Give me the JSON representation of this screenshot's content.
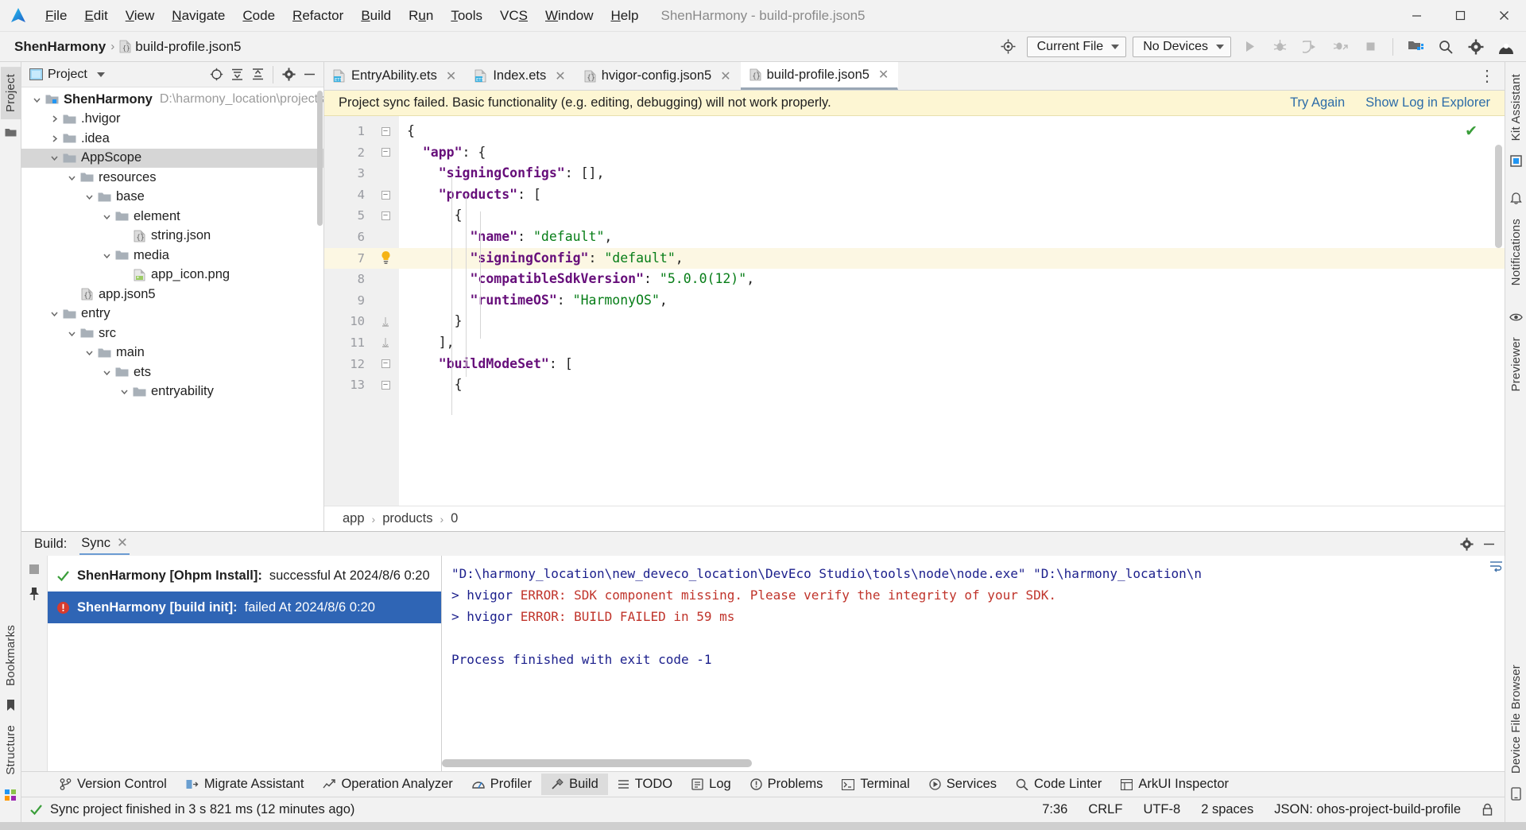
{
  "window": {
    "title": "ShenHarmony - build-profile.json5",
    "minimize": "–",
    "maximize": "❐",
    "close": "✕"
  },
  "menu": {
    "items": [
      {
        "label": "File",
        "mnemonic": "F"
      },
      {
        "label": "Edit",
        "mnemonic": "E"
      },
      {
        "label": "View",
        "mnemonic": "V"
      },
      {
        "label": "Navigate",
        "mnemonic": "N"
      },
      {
        "label": "Code",
        "mnemonic": "C"
      },
      {
        "label": "Refactor",
        "mnemonic": "R"
      },
      {
        "label": "Build",
        "mnemonic": "B"
      },
      {
        "label": "Run",
        "mnemonic": "u"
      },
      {
        "label": "Tools",
        "mnemonic": "T"
      },
      {
        "label": "VCS",
        "mnemonic": "S"
      },
      {
        "label": "Window",
        "mnemonic": "W"
      },
      {
        "label": "Help",
        "mnemonic": "H"
      }
    ]
  },
  "navbar": {
    "project": "ShenHarmony",
    "separator": "›",
    "file": "build-profile.json5",
    "run_config": "Current File",
    "device": "No Devices",
    "icons": [
      "target-icon",
      "run-icon",
      "debug-icon",
      "profile-icon",
      "attach-debugger-icon",
      "stop-icon",
      "project-structure-icon",
      "search-icon",
      "gear-icon",
      "account-icon"
    ]
  },
  "left_strip": {
    "tabs": [
      "Project",
      "Bookmarks",
      "Structure"
    ]
  },
  "right_strip": {
    "tabs": [
      "Kit Assistant",
      "Notifications",
      "Previewer",
      "Device File Browser"
    ]
  },
  "project_panel": {
    "title": "Project",
    "header_icons": [
      "select-opened-file-icon",
      "expand-all-icon",
      "collapse-all-icon",
      "settings-icon",
      "hide-icon"
    ],
    "tree": [
      {
        "label": "ShenHarmony",
        "path": "D:\\harmony_location\\projects\\",
        "depth": 0,
        "twist": "down",
        "icon": "project-folder-icon",
        "bold": true,
        "selected": false
      },
      {
        "label": ".hvigor",
        "path": "",
        "depth": 1,
        "twist": "right",
        "icon": "folder-icon",
        "bold": false,
        "selected": false
      },
      {
        "label": ".idea",
        "path": "",
        "depth": 1,
        "twist": "right",
        "icon": "folder-icon",
        "bold": false,
        "selected": false
      },
      {
        "label": "AppScope",
        "path": "",
        "depth": 1,
        "twist": "down",
        "icon": "folder-icon",
        "bold": false,
        "selected": true
      },
      {
        "label": "resources",
        "path": "",
        "depth": 2,
        "twist": "down",
        "icon": "folder-icon",
        "bold": false,
        "selected": false
      },
      {
        "label": "base",
        "path": "",
        "depth": 3,
        "twist": "down",
        "icon": "folder-icon",
        "bold": false,
        "selected": false
      },
      {
        "label": "element",
        "path": "",
        "depth": 4,
        "twist": "down",
        "icon": "folder-icon",
        "bold": false,
        "selected": false
      },
      {
        "label": "string.json",
        "path": "",
        "depth": 5,
        "twist": "none",
        "icon": "json-file-icon",
        "bold": false,
        "selected": false
      },
      {
        "label": "media",
        "path": "",
        "depth": 4,
        "twist": "down",
        "icon": "folder-icon",
        "bold": false,
        "selected": false
      },
      {
        "label": "app_icon.png",
        "path": "",
        "depth": 5,
        "twist": "none",
        "icon": "image-file-icon",
        "bold": false,
        "selected": false
      },
      {
        "label": "app.json5",
        "path": "",
        "depth": 2,
        "twist": "none",
        "icon": "json-file-icon",
        "bold": false,
        "selected": false
      },
      {
        "label": "entry",
        "path": "",
        "depth": 1,
        "twist": "down",
        "icon": "folder-icon",
        "bold": false,
        "selected": false
      },
      {
        "label": "src",
        "path": "",
        "depth": 2,
        "twist": "down",
        "icon": "folder-icon",
        "bold": false,
        "selected": false
      },
      {
        "label": "main",
        "path": "",
        "depth": 3,
        "twist": "down",
        "icon": "folder-icon",
        "bold": false,
        "selected": false
      },
      {
        "label": "ets",
        "path": "",
        "depth": 4,
        "twist": "down",
        "icon": "folder-icon",
        "bold": false,
        "selected": false
      },
      {
        "label": "entryability",
        "path": "",
        "depth": 5,
        "twist": "down",
        "icon": "folder-icon",
        "bold": false,
        "selected": false
      }
    ]
  },
  "editor": {
    "tabs": [
      {
        "label": "EntryAbility.ets",
        "icon": "ets-file-icon",
        "active": false
      },
      {
        "label": "Index.ets",
        "icon": "ets-file-icon",
        "active": false
      },
      {
        "label": "hvigor-config.json5",
        "icon": "json-file-icon",
        "active": false
      },
      {
        "label": "build-profile.json5",
        "icon": "json-file-icon",
        "active": true
      }
    ],
    "banner": {
      "message": "Project sync failed. Basic functionality (e.g. editing, debugging) will not work properly.",
      "try_again": "Try Again",
      "show_log": "Show Log in Explorer"
    },
    "lines": [
      {
        "num": "1",
        "fold": "minus",
        "indent": 0,
        "highlight": false,
        "tokens": [
          {
            "t": "p",
            "v": "{"
          }
        ]
      },
      {
        "num": "2",
        "fold": "minus",
        "indent": 1,
        "highlight": false,
        "tokens": [
          {
            "t": "k",
            "v": "\"app\""
          },
          {
            "t": "p",
            "v": ": {"
          }
        ]
      },
      {
        "num": "3",
        "fold": "none",
        "indent": 2,
        "highlight": false,
        "tokens": [
          {
            "t": "k",
            "v": "\"signingConfigs\""
          },
          {
            "t": "p",
            "v": ": [],"
          }
        ]
      },
      {
        "num": "4",
        "fold": "minus",
        "indent": 2,
        "highlight": false,
        "tokens": [
          {
            "t": "k",
            "v": "\"products\""
          },
          {
            "t": "p",
            "v": ": ["
          }
        ]
      },
      {
        "num": "5",
        "fold": "minus",
        "indent": 3,
        "highlight": false,
        "tokens": [
          {
            "t": "p",
            "v": "{"
          }
        ]
      },
      {
        "num": "6",
        "fold": "none",
        "indent": 4,
        "highlight": false,
        "tokens": [
          {
            "t": "k",
            "v": "\"name\""
          },
          {
            "t": "p",
            "v": ": "
          },
          {
            "t": "s",
            "v": "\"default\""
          },
          {
            "t": "p",
            "v": ","
          }
        ]
      },
      {
        "num": "7",
        "fold": "bulb",
        "indent": 4,
        "highlight": true,
        "tokens": [
          {
            "t": "k",
            "v": "\"signingConfig\""
          },
          {
            "t": "p",
            "v": ": "
          },
          {
            "t": "s",
            "v": "\"default\""
          },
          {
            "t": "p",
            "v": ","
          }
        ]
      },
      {
        "num": "8",
        "fold": "none",
        "indent": 4,
        "highlight": false,
        "tokens": [
          {
            "t": "k",
            "v": "\"compatibleSdkVersion\""
          },
          {
            "t": "p",
            "v": ": "
          },
          {
            "t": "s",
            "v": "\"5.0.0(12)\""
          },
          {
            "t": "p",
            "v": ","
          }
        ]
      },
      {
        "num": "9",
        "fold": "none",
        "indent": 4,
        "highlight": false,
        "tokens": [
          {
            "t": "k",
            "v": "\"runtimeOS\""
          },
          {
            "t": "p",
            "v": ": "
          },
          {
            "t": "s",
            "v": "\"HarmonyOS\""
          },
          {
            "t": "p",
            "v": ","
          }
        ]
      },
      {
        "num": "10",
        "fold": "plusend",
        "indent": 3,
        "highlight": false,
        "tokens": [
          {
            "t": "p",
            "v": "}"
          }
        ]
      },
      {
        "num": "11",
        "fold": "plusend",
        "indent": 2,
        "highlight": false,
        "tokens": [
          {
            "t": "p",
            "v": "],"
          }
        ]
      },
      {
        "num": "12",
        "fold": "minus",
        "indent": 2,
        "highlight": false,
        "tokens": [
          {
            "t": "k",
            "v": "\"buildModeSet\""
          },
          {
            "t": "p",
            "v": ": ["
          }
        ]
      },
      {
        "num": "13",
        "fold": "minus",
        "indent": 3,
        "highlight": false,
        "tokens": [
          {
            "t": "p",
            "v": "{"
          }
        ]
      }
    ],
    "breadcrumb": [
      "app",
      "products",
      "0"
    ],
    "breadcrumb_sep": "›",
    "inspection_status": "✔"
  },
  "build_panel": {
    "label": "Build:",
    "tab": "Sync",
    "tab_close": "✕",
    "header_icons": [
      "settings-icon",
      "hide-icon"
    ],
    "side_icons": [
      "stop-icon",
      "pin-icon"
    ],
    "tree": [
      {
        "status": "success",
        "title": "ShenHarmony [Ohpm Install]:",
        "result": "successful At 2024/8/6 0:20",
        "selected": false
      },
      {
        "status": "error",
        "title": "ShenHarmony [build init]:",
        "result": "failed At 2024/8/6 0:20",
        "selected": true
      }
    ],
    "console": [
      {
        "segments": [
          {
            "cls": "cons-dark",
            "v": "\"D:\\harmony_location\\new_deveco_location\\DevEco Studio\\tools\\node\\node.exe\" \"D:\\harmony_location\\n"
          }
        ]
      },
      {
        "segments": [
          {
            "cls": "cons-dark",
            "v": "> hvigor "
          },
          {
            "cls": "cons-red",
            "v": "ERROR: SDK component missing. Please verify the integrity of your SDK."
          }
        ]
      },
      {
        "segments": [
          {
            "cls": "cons-dark",
            "v": "> hvigor "
          },
          {
            "cls": "cons-red",
            "v": "ERROR: BUILD FAILED in 59 ms"
          }
        ]
      },
      {
        "segments": [
          {
            "cls": "cons-dark",
            "v": ""
          }
        ]
      },
      {
        "segments": [
          {
            "cls": "cons-blue",
            "v": "Process finished with exit code -1"
          }
        ]
      }
    ]
  },
  "tool_window_bar": {
    "items": [
      {
        "label": "Version Control",
        "icon": "branch-icon",
        "active": false
      },
      {
        "label": "Migrate Assistant",
        "icon": "migrate-icon",
        "active": false
      },
      {
        "label": "Operation Analyzer",
        "icon": "analyzer-icon",
        "active": false
      },
      {
        "label": "Profiler",
        "icon": "profiler-icon",
        "active": false
      },
      {
        "label": "Build",
        "icon": "build-hammer-icon",
        "active": true
      },
      {
        "label": "TODO",
        "icon": "todo-icon",
        "active": false
      },
      {
        "label": "Log",
        "icon": "log-icon",
        "active": false
      },
      {
        "label": "Problems",
        "icon": "problems-icon",
        "active": false
      },
      {
        "label": "Terminal",
        "icon": "terminal-icon",
        "active": false
      },
      {
        "label": "Services",
        "icon": "services-icon",
        "active": false
      },
      {
        "label": "Code Linter",
        "icon": "linter-icon",
        "active": false
      },
      {
        "label": "ArkUI Inspector",
        "icon": "inspector-icon",
        "active": false
      }
    ]
  },
  "status_bar": {
    "message": "Sync project finished in 3 s 821 ms (12 minutes ago)",
    "caret": "7:36",
    "line_sep": "CRLF",
    "encoding": "UTF-8",
    "indent": "2 spaces",
    "schema": "JSON: ohos-project-build-profile",
    "lock_icon": "lock-icon"
  },
  "colors": {
    "accent_blue": "#2f65b5",
    "error_red": "#c0342b",
    "warning_bg": "#fdf6d3",
    "success_green": "#3a9e3a",
    "json_key": "#660e7a",
    "json_string": "#067d17"
  }
}
